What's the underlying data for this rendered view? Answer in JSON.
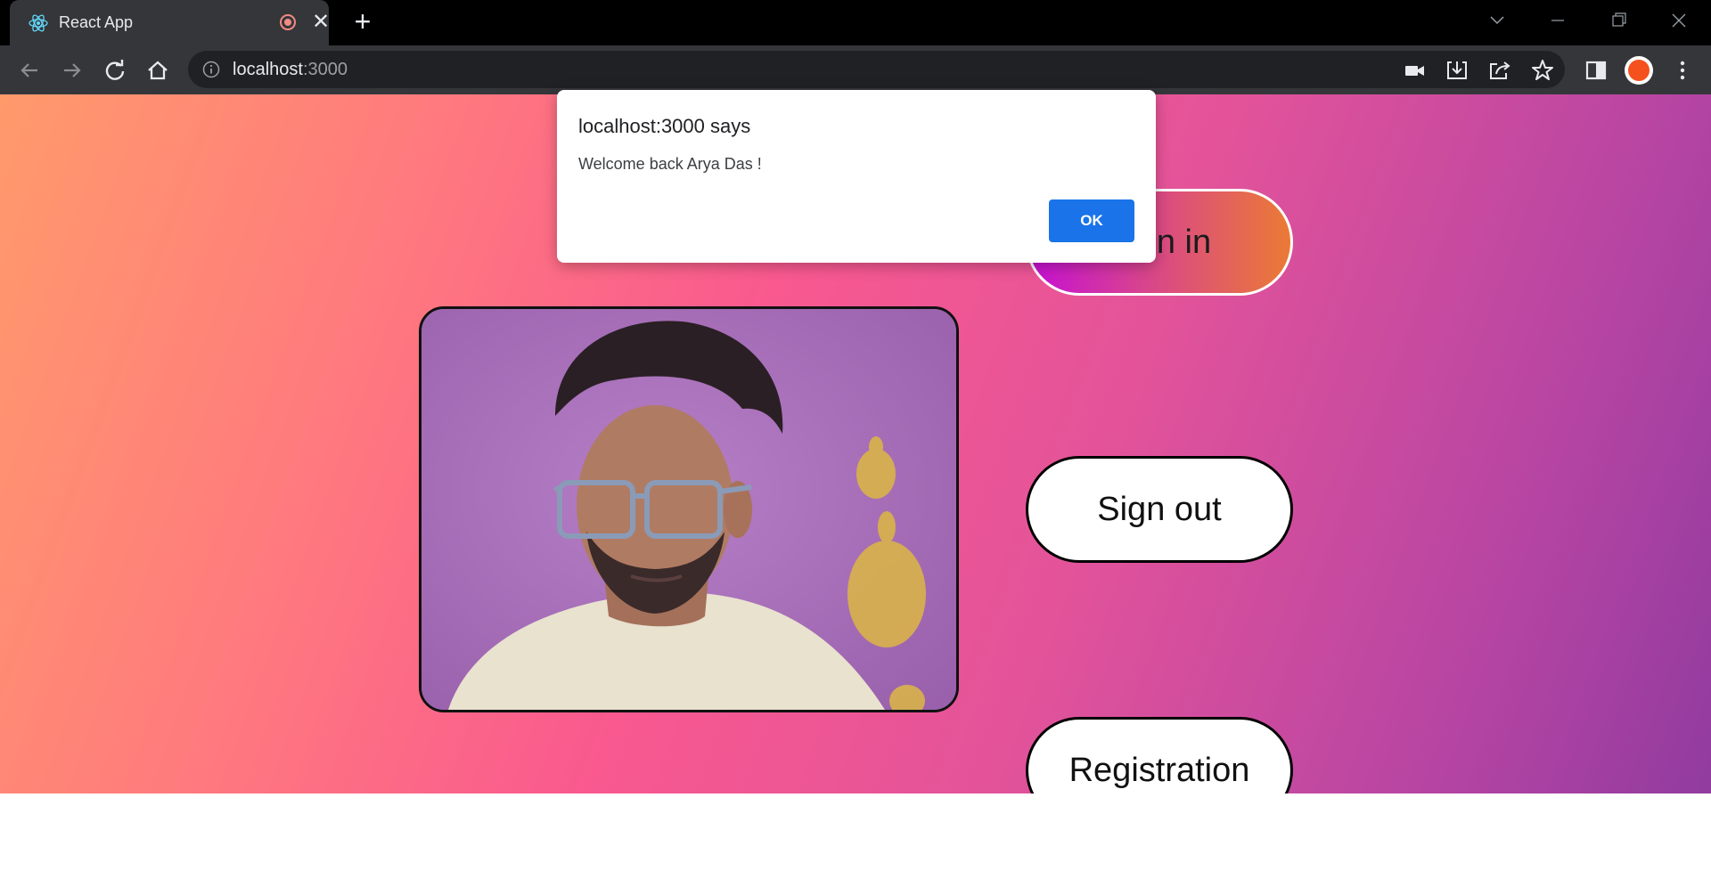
{
  "browser": {
    "tab_title": "React App",
    "close_glyph": "✕",
    "new_tab_glyph": "+",
    "url_host": "localhost",
    "url_port": ":3000"
  },
  "page": {
    "buttons": {
      "signin": "Sign in",
      "signout": "Sign out",
      "registration": "Registration"
    },
    "webcam_alt": "Webcam feed"
  },
  "dialog": {
    "title": "localhost:3000 says",
    "message": "Welcome back Arya Das !",
    "ok_label": "OK"
  },
  "colors": {
    "accent": "#1a73e8",
    "signin_gradient_start": "#c60fd6",
    "signin_gradient_end": "#eb7a35"
  }
}
